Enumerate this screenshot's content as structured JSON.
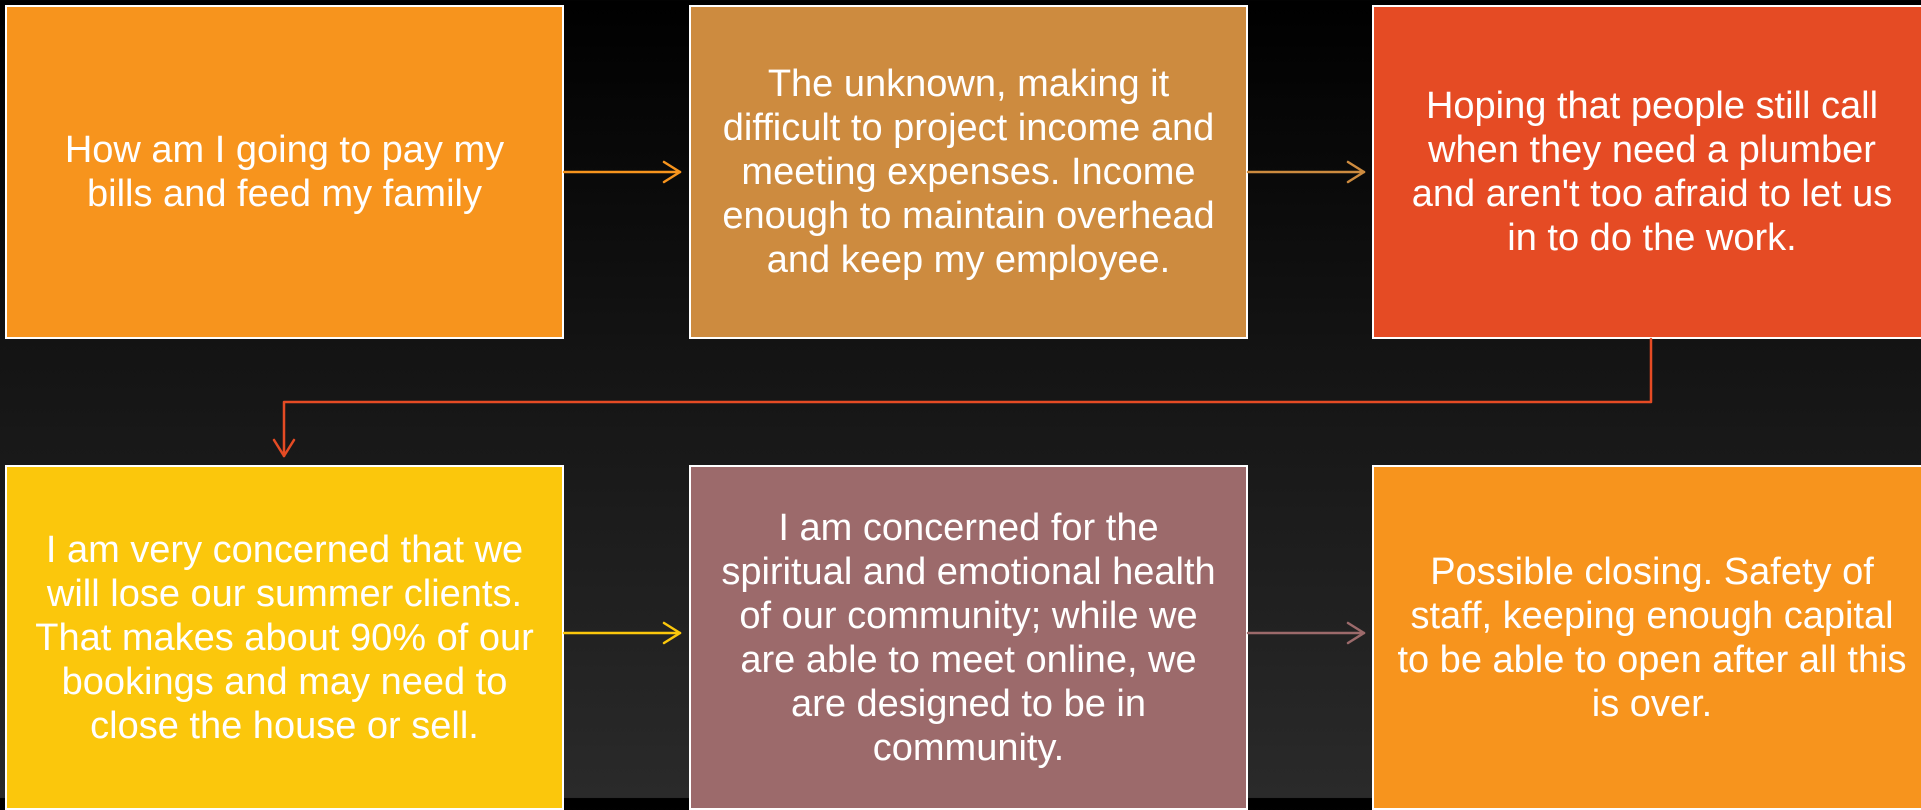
{
  "boxes": [
    {
      "text": "How am I going to pay my bills and feed my family",
      "color": "#f7941d"
    },
    {
      "text": "The unknown, making it difficult to project income and meeting expenses. Income enough to maintain overhead and keep my employee.",
      "color": "#cd8b3f"
    },
    {
      "text": "Hoping that people still call when they need a plumber and aren't too afraid to let us in to do the work.",
      "color": "#e54b24"
    },
    {
      "text": "I am very concerned that we will lose our summer clients.  That makes about 90% of our bookings and may need to close the house or sell.",
      "color": "#fbc70c"
    },
    {
      "text": "I am concerned for the spiritual and emotional health of our community; while we are able to meet online, we are designed to be in community.",
      "color": "#9c6a6b"
    },
    {
      "text": "Possible closing. Safety of staff, keeping enough capital to be able to open after all this is over.",
      "color": "#f7941d"
    }
  ],
  "connector_colors": {
    "box1_to_box2": "#f7941d",
    "box2_to_box3": "#cd8b3f",
    "box3_to_box4": "#e54b24",
    "box4_to_box5": "#fbc70c",
    "box5_to_box6": "#9c6a6b"
  }
}
